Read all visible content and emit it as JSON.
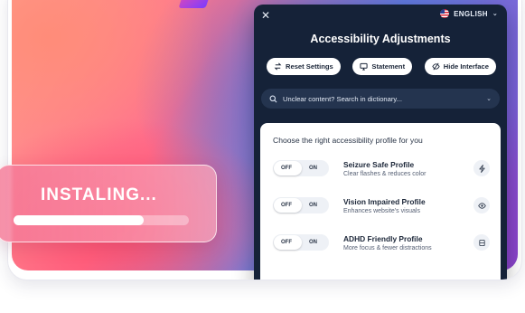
{
  "install": {
    "label": "INSTALING...",
    "progress": 0.74
  },
  "panel": {
    "language": "ENGLISH",
    "title": "Accessibility Adjustments",
    "actions": [
      {
        "label": "Reset Settings",
        "icon": "reset-icon"
      },
      {
        "label": "Statement",
        "icon": "monitor-icon"
      },
      {
        "label": "Hide Interface",
        "icon": "eye-slash-icon"
      }
    ],
    "search": {
      "placeholder": "Unclear content? Search in dictionary..."
    },
    "card": {
      "heading": "Choose the right accessibility profile for you",
      "profiles": [
        {
          "name": "Seizure Safe Profile",
          "desc": "Clear flashes & reduces color",
          "off": "OFF",
          "on": "ON",
          "icon": "bolt-icon"
        },
        {
          "name": "Vision Impaired Profile",
          "desc": "Enhances website's visuals",
          "off": "OFF",
          "on": "ON",
          "icon": "eye-icon"
        },
        {
          "name": "ADHD Friendly Profile",
          "desc": "More focus & fewer distractions",
          "off": "OFF",
          "on": "ON",
          "icon": "focus-icon"
        }
      ]
    }
  },
  "colors": {
    "panel_bg": "#152238",
    "search_bg": "#24344f",
    "install_bg": "#f578a0"
  }
}
